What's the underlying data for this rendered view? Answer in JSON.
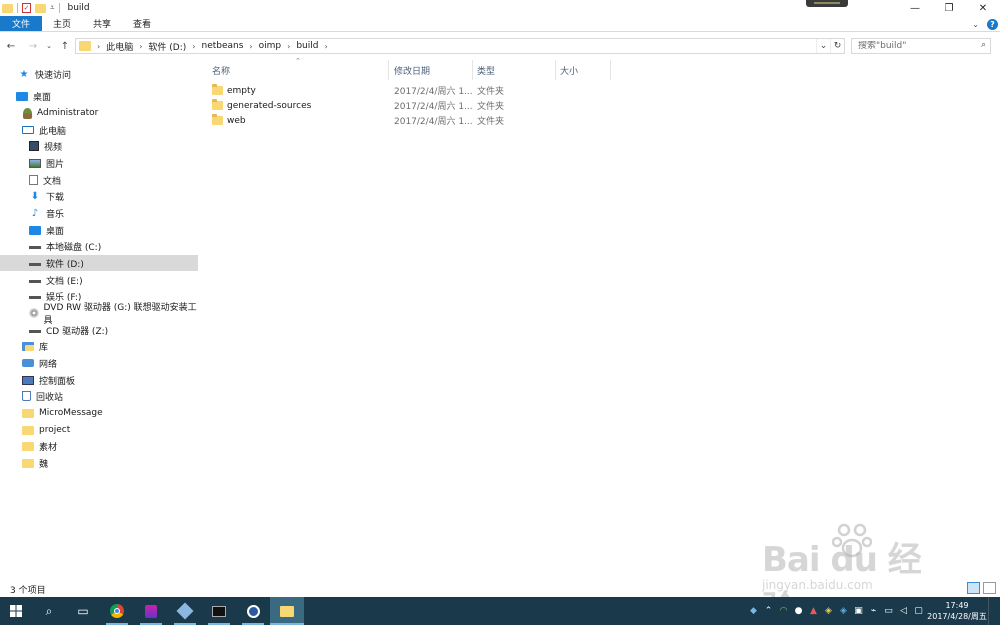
{
  "window": {
    "title": "build",
    "controls": {
      "minimize": "—",
      "maximize": "❐",
      "close": "✕"
    }
  },
  "ribbon": {
    "tabs": [
      {
        "label": "文件",
        "active": true
      },
      {
        "label": "主页"
      },
      {
        "label": "共享"
      },
      {
        "label": "查看"
      }
    ]
  },
  "address": {
    "crumbs": [
      "此电脑",
      "软件 (D:)",
      "netbeans",
      "oimp",
      "build"
    ]
  },
  "search": {
    "placeholder": "搜索\"build\""
  },
  "sidebar": {
    "items": [
      {
        "label": "快速访问",
        "icon": "star-icon"
      },
      {
        "label": "桌面",
        "icon": "desktop-icon"
      },
      {
        "label": "Administrator",
        "icon": "user-icon"
      },
      {
        "label": "此电脑",
        "icon": "computer-icon"
      },
      {
        "label": "视频",
        "icon": "video-icon"
      },
      {
        "label": "图片",
        "icon": "picture-icon"
      },
      {
        "label": "文档",
        "icon": "document-icon"
      },
      {
        "label": "下载",
        "icon": "download-icon"
      },
      {
        "label": "音乐",
        "icon": "music-icon"
      },
      {
        "label": "桌面",
        "icon": "desktop-icon"
      },
      {
        "label": "本地磁盘 (C:)",
        "icon": "drive-icon"
      },
      {
        "label": "软件 (D:)",
        "icon": "drive-icon",
        "selected": true
      },
      {
        "label": "文档 (E:)",
        "icon": "drive-icon"
      },
      {
        "label": "娱乐 (F:)",
        "icon": "drive-icon"
      },
      {
        "label": "DVD RW 驱动器 (G:) 联想驱动安装工具",
        "icon": "dvd-drive-icon"
      },
      {
        "label": "CD 驱动器 (Z:)",
        "icon": "cd-drive-icon"
      },
      {
        "label": "库",
        "icon": "library-icon"
      },
      {
        "label": "网络",
        "icon": "network-icon"
      },
      {
        "label": "控制面板",
        "icon": "control-panel-icon"
      },
      {
        "label": "回收站",
        "icon": "recycle-bin-icon"
      },
      {
        "label": "MicroMessage",
        "icon": "folder-icon"
      },
      {
        "label": "project",
        "icon": "folder-icon"
      },
      {
        "label": "素材",
        "icon": "folder-icon"
      },
      {
        "label": "魏",
        "icon": "folder-icon"
      }
    ]
  },
  "columns": {
    "name": "名称",
    "date": "修改日期",
    "type": "类型",
    "size": "大小"
  },
  "files": [
    {
      "name": "empty",
      "date": "2017/2/4/周六 1...",
      "type": "文件夹"
    },
    {
      "name": "generated-sources",
      "date": "2017/2/4/周六 1...",
      "type": "文件夹"
    },
    {
      "name": "web",
      "date": "2017/2/4/周六 1...",
      "type": "文件夹"
    }
  ],
  "status": {
    "item_count": "3 个项目"
  },
  "watermark": {
    "main": "Bai du 经验",
    "sub": "jingyan.baidu.com"
  },
  "taskbar": {
    "clock_time": "17:49",
    "clock_date": "2017/4/28/周五"
  },
  "colors": {
    "accent": "#1979ca",
    "taskbar": "#1a3a4c",
    "folder": "#f8d775",
    "selected_row": "#d9d9d9",
    "header_text": "#4c607a"
  }
}
